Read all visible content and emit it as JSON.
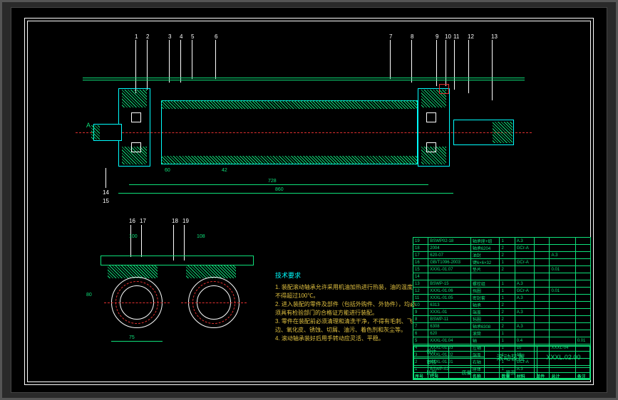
{
  "callouts_top_left": [
    "1",
    "2",
    "3",
    "4",
    "5",
    "6"
  ],
  "callouts_top_right": [
    "7",
    "8",
    "9",
    "10",
    "11",
    "12",
    "13"
  ],
  "callouts_bottom_left": [
    "14",
    "15"
  ],
  "callouts_side": [
    "16",
    "17",
    "18",
    "19"
  ],
  "marker_a": "A",
  "dimensions": {
    "main_len1": "728",
    "main_len2": "860",
    "main_small1": "60",
    "main_small2": "42",
    "side_w1": "100",
    "side_w2": "75",
    "side_h": "80",
    "side_gap": "108"
  },
  "notes": {
    "title": "技术要求",
    "line1": "1. 装配滚动轴承允许采用机油加热进行热装，油的温度不得超过100℃。",
    "line2": "2. 进入装配的零件及部件（包括外购件、外协件），均必须具有检验部门的合格证方能进行装配。",
    "line3": "3. 零件在装配前必须清理和清洗干净，不得有毛刺、飞边、氧化皮、锈蚀、切屑、油污、着色剂和灰尘等。",
    "line4": "4. 滚动轴承装好后用手转动应灵活、平稳。"
  },
  "bom_header": [
    "序号",
    "代号",
    "名称",
    "数量",
    "材料",
    "单件",
    "总计",
    "备注"
  ],
  "bom_rows": [
    [
      "19",
      "BSWP02-18",
      "轴承座+组",
      "1",
      "A.3",
      "",
      "",
      ""
    ],
    [
      "18",
      "2004",
      "轴承6204",
      "2",
      "GCr-A",
      "",
      "",
      ""
    ],
    [
      "17",
      "620-07",
      "油封",
      "2",
      "",
      "",
      "A.3",
      ""
    ],
    [
      "16",
      "GB/T1096-2003",
      "键6×6×32",
      "1",
      "GCr-A",
      "",
      "",
      ""
    ],
    [
      "15",
      "XXXL-01.07",
      "垫片",
      "2",
      "",
      "",
      "0.01",
      ""
    ],
    [
      "14",
      "",
      "",
      "",
      "",
      "",
      "",
      ""
    ],
    [
      "13",
      "BSWP-15",
      "螺栓组",
      "1",
      "A.3",
      "",
      "",
      ""
    ],
    [
      "12",
      "XXXL-01.06",
      "挡圈",
      "1",
      "GCr-A",
      "",
      "0.01",
      ""
    ],
    [
      "11",
      "XXXL-01.05",
      "密封套",
      "1",
      "A.3",
      "",
      "",
      ""
    ],
    [
      "10",
      "6313",
      "轴承",
      "2",
      "",
      "",
      "",
      ""
    ],
    [
      "9",
      "XXXL-01",
      "端盖",
      "2",
      "A.3",
      "",
      "",
      ""
    ],
    [
      "8",
      "BSWP-11",
      "毡圈",
      "2",
      "",
      "",
      "",
      ""
    ],
    [
      "7",
      "6308",
      "轴承6308",
      "2",
      "A.3",
      "",
      "",
      ""
    ],
    [
      "6",
      "620",
      "滚筒",
      "1",
      "",
      "",
      "",
      ""
    ],
    [
      "5",
      "XXXL-01.04",
      "轴",
      "1",
      "0.4",
      "",
      "",
      "0.01"
    ],
    [
      "4",
      "XXXL-01.03",
      "左轴",
      "1",
      "10",
      "",
      "XXXL-04",
      ""
    ],
    [
      "3",
      "XXXL-01.02",
      "端盖",
      "1",
      "10",
      "",
      "",
      ""
    ],
    [
      "2",
      "XXXL-01.01",
      "右轴",
      "1",
      "GCr-A",
      "",
      "",
      ""
    ],
    [
      "1",
      "BSWP-02",
      "座体",
      "1",
      "A.3",
      "",
      "",
      ""
    ]
  ],
  "title_block": {
    "name_label": "名称",
    "drawing_title": "滚动装置",
    "drawing_no": "XXXL.02.00",
    "scale": "比例",
    "mass": "质量",
    "sheet": "第页",
    "design": "设计",
    "check": "审核"
  }
}
